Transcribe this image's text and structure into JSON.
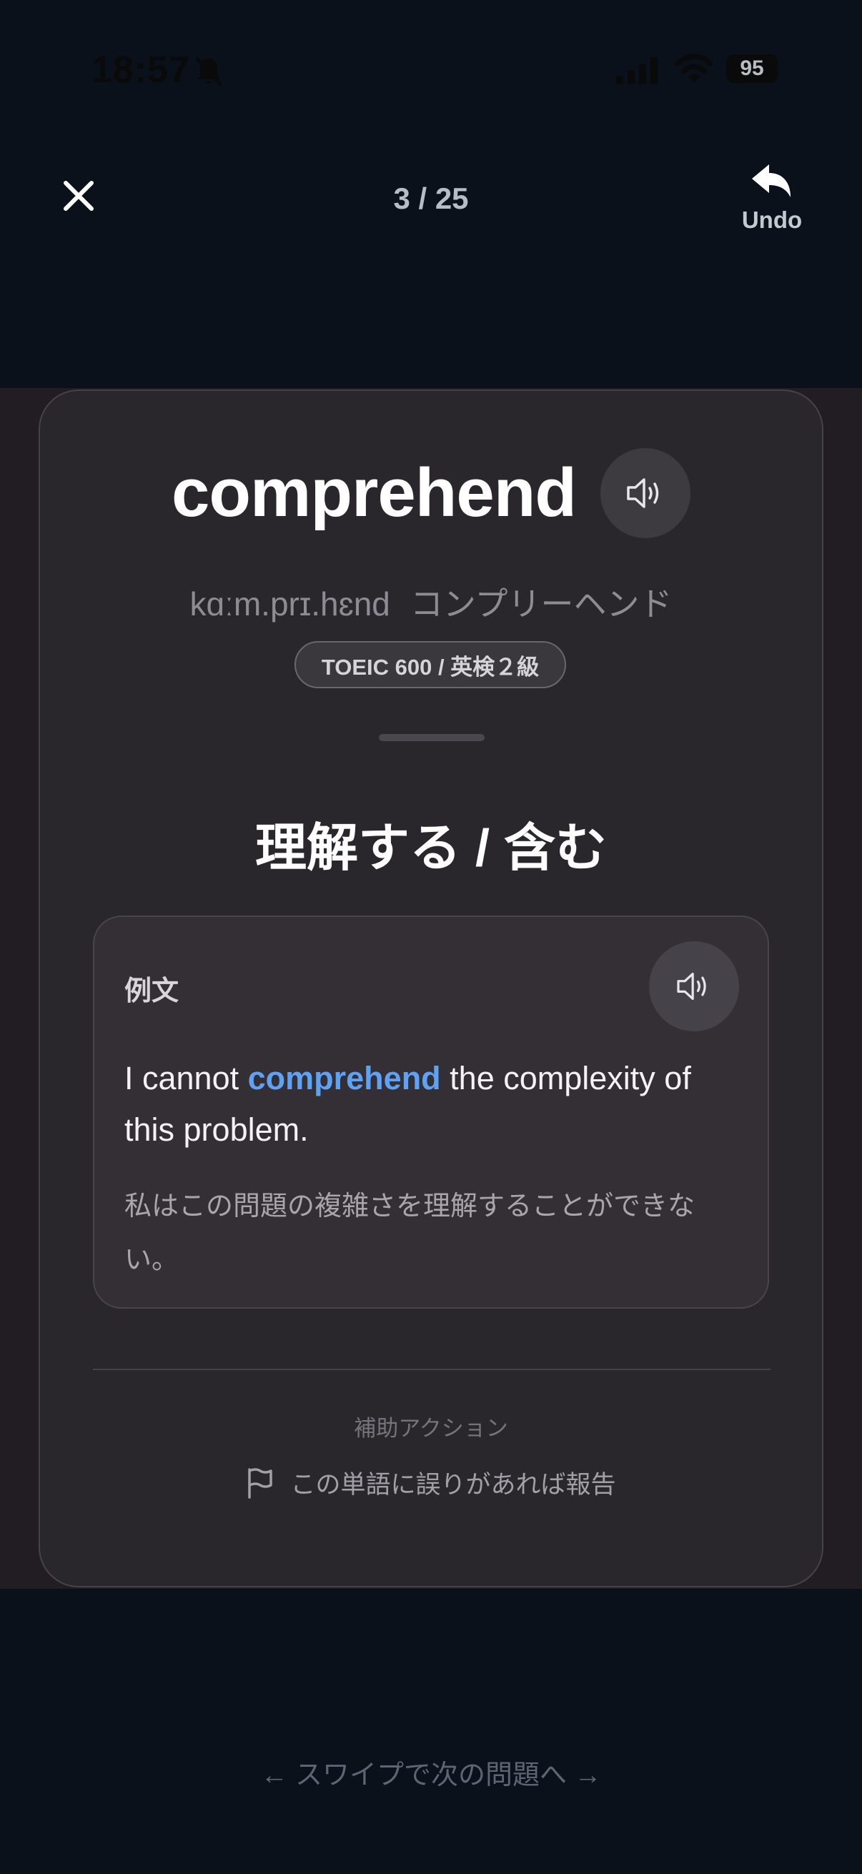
{
  "status_bar": {
    "time": "18:57",
    "battery": "95"
  },
  "header": {
    "progress": "3 / 25",
    "undo_label": "Undo"
  },
  "card": {
    "word": "comprehend",
    "pronunciation_ipa": "kɑːm.prɪ.hɛnd",
    "pronunciation_kana": "コンプリーヘンド",
    "level": "TOEIC 600 / 英検２級",
    "meaning": "理解する / 含む",
    "example": {
      "label": "例文",
      "sentence_before": "I cannot ",
      "sentence_highlight": "comprehend",
      "sentence_after": " the complexity of this problem.",
      "translation": "私はこの問題の複雑さを理解することができない。"
    },
    "aux_actions_title": "補助アクション",
    "report_label": "この単語に誤りがあれば報告"
  },
  "swipe_hint": "← スワイプで次の問題へ →",
  "colors": {
    "background": "#0b111b",
    "card": "#2a272c",
    "highlight": "#5fa2f4"
  }
}
